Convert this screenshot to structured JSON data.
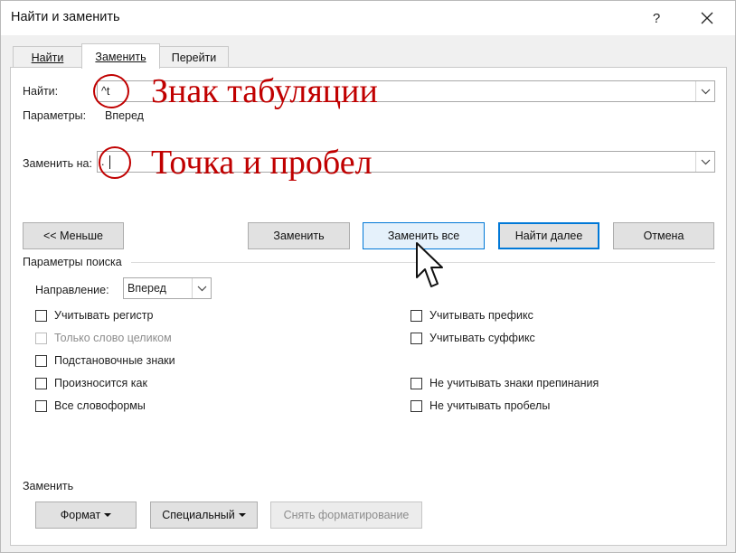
{
  "window": {
    "title": "Найти и заменить",
    "help_label": "?",
    "close_label": "✕"
  },
  "tabs": [
    {
      "label": "Найти",
      "active": false
    },
    {
      "label": "Заменить",
      "active": true
    },
    {
      "label": "Перейти",
      "active": false
    }
  ],
  "find": {
    "label": "Найти:",
    "value": "^t",
    "options_label": "Параметры:",
    "options_value": "Вперед"
  },
  "replace": {
    "label": "Заменить на:",
    "value": ". "
  },
  "annotations": {
    "find_note": "Знак табуляции",
    "replace_note": "Точка и пробел",
    "color": "#c00000"
  },
  "buttons": {
    "less": "<< Меньше",
    "replace": "Заменить",
    "replace_all": "Заменить все",
    "find_next": "Найти далее",
    "cancel": "Отмена"
  },
  "search_options": {
    "group_label": "Параметры поиска",
    "direction_label": "Направление:",
    "direction_value": "Вперед",
    "left_checkboxes": [
      {
        "label": "Учитывать регистр",
        "checked": false,
        "enabled": true
      },
      {
        "label": "Только слово целиком",
        "checked": false,
        "enabled": false
      },
      {
        "label": "Подстановочные знаки",
        "checked": false,
        "enabled": true
      },
      {
        "label": "Произносится как",
        "checked": false,
        "enabled": true
      },
      {
        "label": "Все словоформы",
        "checked": false,
        "enabled": true
      }
    ],
    "right_checkboxes": [
      {
        "label": "Учитывать префикс",
        "checked": false,
        "enabled": true
      },
      {
        "label": "Учитывать суффикс",
        "checked": false,
        "enabled": true
      },
      {
        "label": "Не учитывать знаки препинания",
        "checked": false,
        "enabled": true
      },
      {
        "label": "Не учитывать пробелы",
        "checked": false,
        "enabled": true
      }
    ]
  },
  "replace_section": {
    "label": "Заменить",
    "format": "Формат",
    "special": "Специальный",
    "clear_formatting": "Снять форматирование"
  },
  "colors": {
    "accent": "#0078d7",
    "dialog_bg": "#f0f0f0",
    "panel_bg": "#ffffff"
  }
}
